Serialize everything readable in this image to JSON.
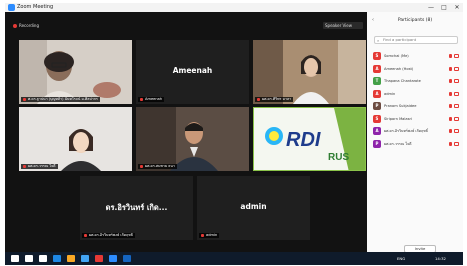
{
  "window": {
    "title": "Zoom Meeting",
    "controls": [
      "—",
      "□",
      "✕"
    ]
  },
  "meeting": {
    "recording_label": "Recording",
    "view_button": "Speaker View",
    "tiles": [
      {
        "id": "t1",
        "label": "ศ.ดร.ฐาปนา (บุญหล้า) ฉันทโรจน์ ม.ศิลปากร"
      },
      {
        "id": "t2",
        "label": "Ameenah",
        "display_name": "Ameenah"
      },
      {
        "id": "t3",
        "label": "ผศ.ดร.ศิริพร มาลา"
      },
      {
        "id": "t4",
        "label": "ผศ.ดร.วรรณ ใจดี"
      },
      {
        "id": "t5",
        "label": "ผศ.ดร.สมชาย ธนา"
      },
      {
        "id": "t6",
        "label": "RDI RUS",
        "logo_text_1": "RDI",
        "logo_text_2": "RUS"
      },
      {
        "id": "t7",
        "label": "ผศ.ดร.อิรวินทร์พงษ์ เกิดฤทธิ์",
        "display_name": "ดร.อิรวินทร์ เกิด..."
      },
      {
        "id": "t8",
        "label": "admin",
        "display_name": "admin"
      }
    ]
  },
  "participants": {
    "title": "Participants (8)",
    "search_placeholder": "Find a participant",
    "list": [
      {
        "initial": "S",
        "name": "Somchai (Me)",
        "color": "#e53935"
      },
      {
        "initial": "A",
        "name": "Ameenah (Host)",
        "color": "#e53935"
      },
      {
        "initial": "T",
        "name": "Thapana Chantarote",
        "color": "#43a047"
      },
      {
        "initial": "A",
        "name": "admin",
        "color": "#e53935"
      },
      {
        "initial": "P",
        "name": "Pranom Sukjaidee",
        "color": "#6d4c41"
      },
      {
        "initial": "S",
        "name": "Siriporn Malasri",
        "color": "#e53935"
      },
      {
        "initial": "A",
        "name": "ผศ.ดร.อิรวินทร์พงษ์ เกิดฤทธิ์",
        "color": "#8e24aa"
      },
      {
        "initial": "P",
        "name": "ผศ.ดร.วรรณ ใจดี",
        "color": "#8e24aa"
      }
    ],
    "invite_button": "Invite"
  },
  "taskbar": {
    "items": [
      "windows",
      "search",
      "task-view",
      "edge",
      "explorer",
      "store",
      "chrome",
      "zoom",
      "word"
    ],
    "item_colors": [
      "#ffffff",
      "#ffffff",
      "#ffffff",
      "#1e88e5",
      "#f9a825",
      "#42a5f5",
      "#e53935",
      "#2d8cff",
      "#1565c0"
    ],
    "tray_text": "ENG",
    "clock": "14:32"
  }
}
